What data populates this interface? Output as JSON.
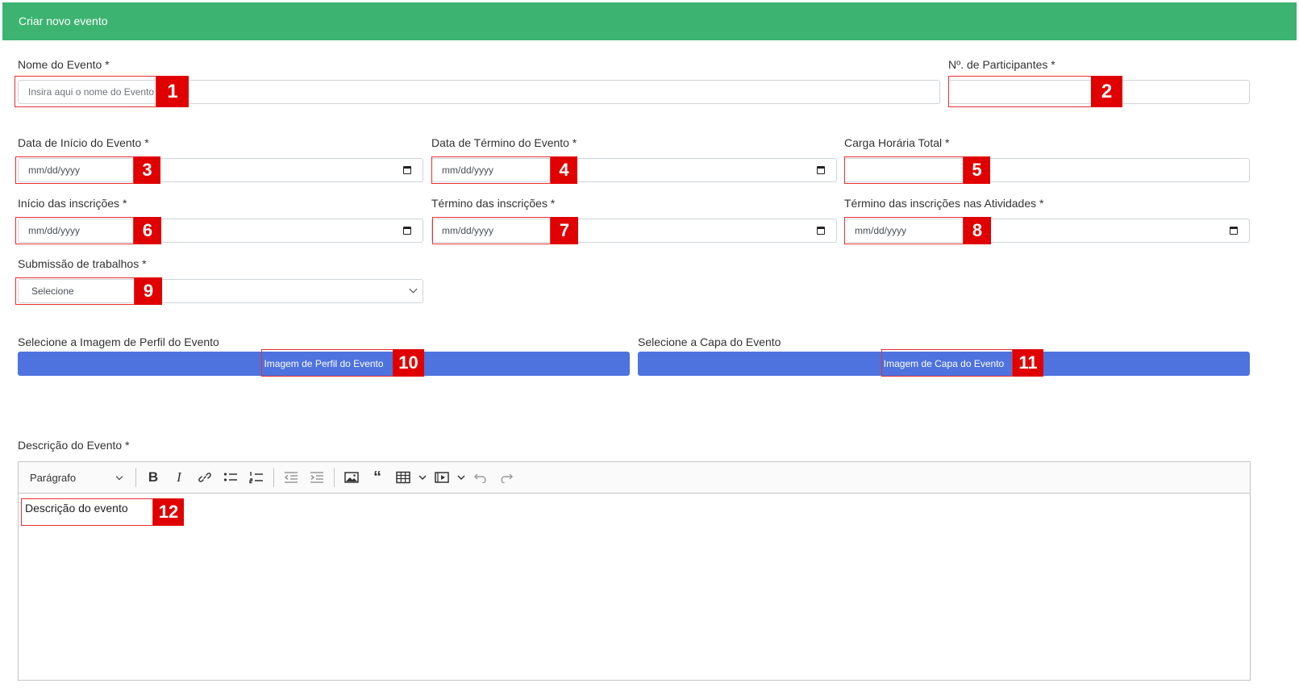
{
  "header": {
    "title": "Criar novo evento"
  },
  "fields": {
    "nome_label": "Nome do Evento *",
    "nome_placeholder": "Insira aqui o nome do Evento",
    "participantes_label": "Nº. de Participantes *",
    "data_inicio_label": "Data de Início do Evento *",
    "data_termino_label": "Data de Término do Evento *",
    "carga_label": "Carga Horária Total *",
    "inicio_insc_label": "Início das inscrições *",
    "termino_insc_label": "Término das inscrições *",
    "termino_insc_ativ_label": "Término das inscrições nas Atividades *",
    "submissao_label": "Submissão de trabalhos *",
    "submissao_value": "Selecione",
    "date_placeholder": "mm/dd/yyyy"
  },
  "uploads": {
    "perfil_label": "Selecione a Imagem de Perfil do Evento",
    "perfil_button": "Imagem de Perfil do Evento",
    "capa_label": "Selecione a Capa do Evento",
    "capa_button": "Imagem de Capa do Evento"
  },
  "editor": {
    "label": "Descrição do Evento *",
    "paragraph_select": "Parágrafo",
    "content": "Descrição do evento",
    "toolbar_icons": [
      "bold-icon",
      "italic-icon",
      "link-icon",
      "bulleted-list-icon",
      "numbered-list-icon",
      "outdent-icon",
      "indent-icon",
      "image-icon",
      "blockquote-icon",
      "table-icon",
      "media-icon",
      "undo-icon",
      "redo-icon"
    ]
  },
  "badges": [
    "1",
    "2",
    "3",
    "4",
    "5",
    "6",
    "7",
    "8",
    "9",
    "10",
    "11",
    "12"
  ],
  "colors": {
    "header": "#3cb371",
    "button": "#4e73df",
    "highlight": "#e00000"
  }
}
